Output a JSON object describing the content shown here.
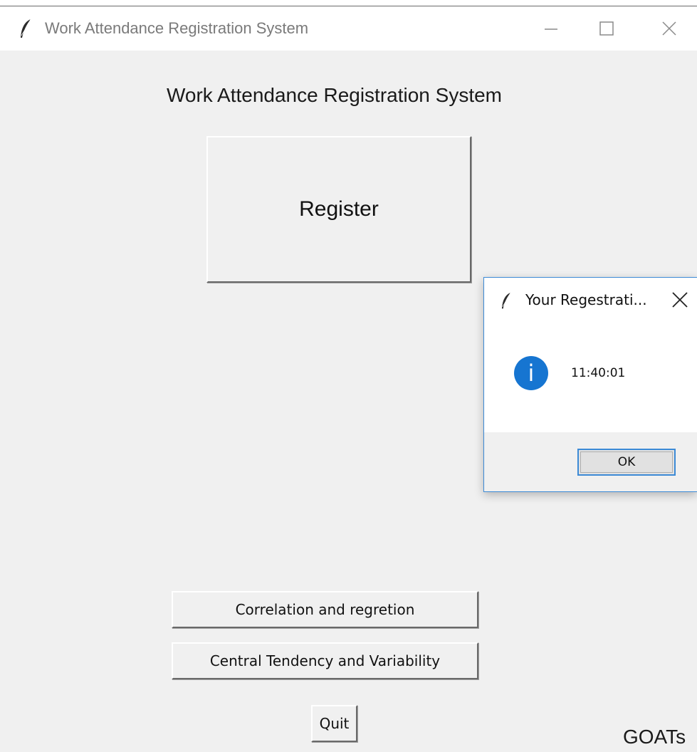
{
  "window": {
    "title": "Work Attendance Registration System",
    "app_icon": "feather-icon",
    "controls": [
      "minimize-icon",
      "maximize-icon",
      "close-icon"
    ]
  },
  "main": {
    "heading": "Work Attendance Registration System",
    "register_label": "Register",
    "correlation_label": "Correlation and regretion",
    "central_tendency_label": "Central Tendency and Variability",
    "quit_label": "Quit",
    "footer_text": "GOATs"
  },
  "dialog": {
    "title": "Your Regestrati...",
    "icon": "info-icon",
    "info_glyph": "i",
    "message": "11:40:01",
    "ok_label": "OK",
    "accent": "#1675d1"
  }
}
